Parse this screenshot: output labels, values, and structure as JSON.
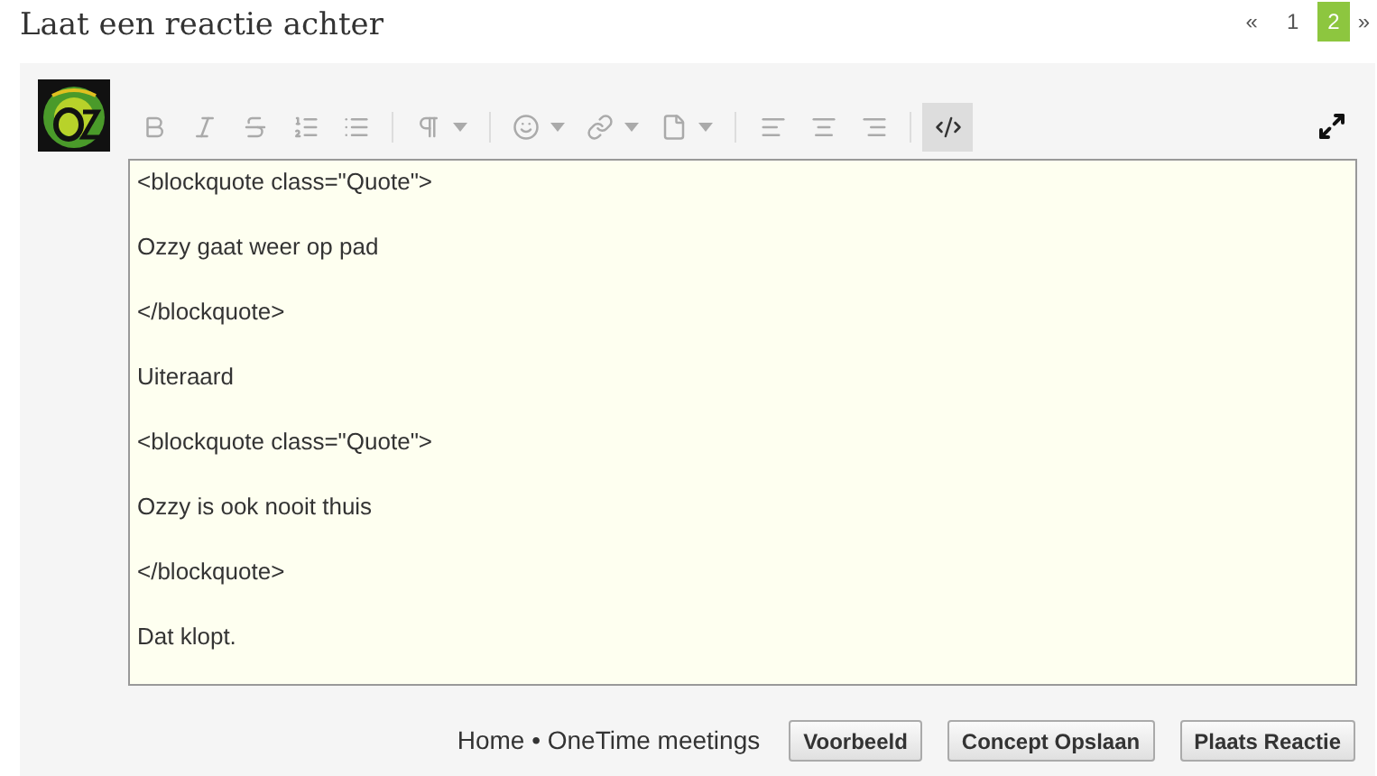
{
  "heading": "Laat een reactie achter",
  "pagination": {
    "prev": "«",
    "next": "»",
    "pages": [
      {
        "label": "1",
        "selected": false
      },
      {
        "label": "2",
        "selected": true
      }
    ]
  },
  "toolbar": [
    {
      "kind": "button",
      "selected": false
    },
    {
      "kind": "button",
      "selected": false
    },
    {
      "kind": "button",
      "selected": false
    },
    {
      "kind": "button",
      "selected": false
    },
    {
      "kind": "button",
      "selected": false
    },
    {
      "kind": "separator"
    },
    {
      "kind": "dropdown",
      "selected": false
    },
    {
      "kind": "separator"
    },
    {
      "kind": "dropdown",
      "selected": false
    },
    {
      "kind": "dropdown",
      "selected": false
    },
    {
      "kind": "dropdown",
      "selected": false
    },
    {
      "kind": "separator"
    },
    {
      "kind": "button",
      "selected": false
    },
    {
      "kind": "button",
      "selected": false
    },
    {
      "kind": "button",
      "selected": false
    },
    {
      "kind": "separator"
    },
    {
      "kind": "button",
      "selected": true
    }
  ],
  "editor_lines": [
    "<blockquote class=\"Quote\">",
    "Ozzy gaat weer op pad",
    "</blockquote>",
    "Uiteraard",
    "<blockquote class=\"Quote\">",
    "Ozzy is ook nooit thuis",
    "</blockquote>",
    "Dat klopt."
  ],
  "footer": {
    "breadcrumb": "Home • OneTime meetings",
    "buttons": [
      "Voorbeeld",
      "Concept Opslaan",
      "Plaats Reactie"
    ]
  }
}
